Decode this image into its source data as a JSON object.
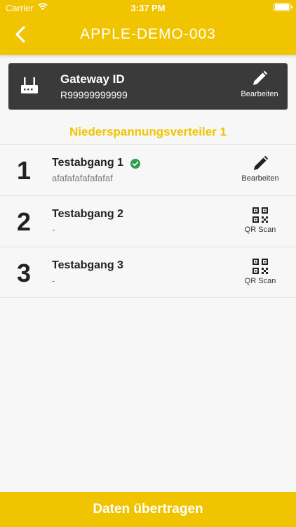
{
  "status_bar": {
    "carrier": "Carrier",
    "time": "3:37 PM"
  },
  "header": {
    "title": "APPLE-DEMO-003"
  },
  "gateway": {
    "label": "Gateway ID",
    "value": "R99999999999",
    "edit_label": "Bearbeiten"
  },
  "section": {
    "title": "Niederspannungsverteiler 1"
  },
  "rows": [
    {
      "number": "1",
      "title": "Testabgang 1",
      "subtitle": "afafafafafafafaf",
      "verified": true,
      "action_label": "Bearbeiten",
      "action_icon": "pencil-icon"
    },
    {
      "number": "2",
      "title": "Testabgang 2",
      "subtitle": "-",
      "verified": false,
      "action_label": "QR Scan",
      "action_icon": "qr-code-icon"
    },
    {
      "number": "3",
      "title": "Testabgang 3",
      "subtitle": "-",
      "verified": false,
      "action_label": "QR Scan",
      "action_icon": "qr-code-icon"
    }
  ],
  "footer": {
    "button_label": "Daten übertragen"
  },
  "colors": {
    "accent": "#f0c400",
    "dark_card": "#3a3a3a",
    "success": "#2e9e4f"
  }
}
